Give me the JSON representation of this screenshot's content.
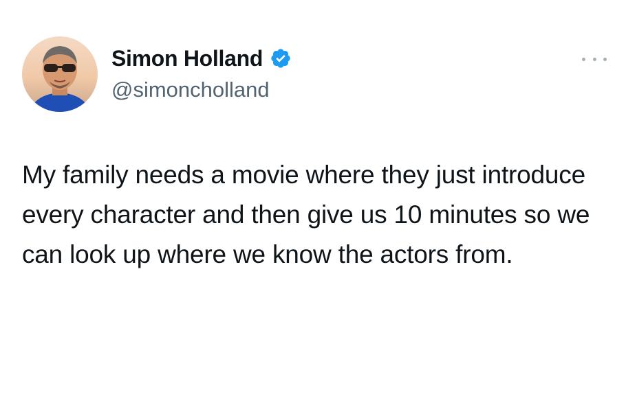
{
  "author": {
    "display_name": "Simon Holland",
    "handle": "@simoncholland",
    "verified": true,
    "avatar_icon": "profile-photo"
  },
  "tweet": {
    "text": "My family needs a movie where they just introduce every character and then give us 10 minutes so we can look up where we know the actors from."
  },
  "icons": {
    "verified_badge": "verified-badge-icon",
    "more_options": "more-options-icon"
  },
  "colors": {
    "text_primary": "#0f1419",
    "text_secondary": "#536471",
    "verified_blue": "#1d9bf0",
    "more_dots": "#a4afb8"
  }
}
